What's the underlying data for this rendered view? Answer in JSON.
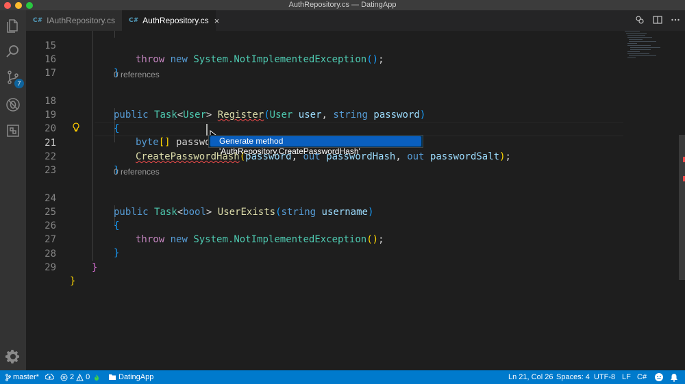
{
  "window": {
    "title": "AuthRepository.cs — DatingApp"
  },
  "activity_bar": {
    "items": [
      {
        "name": "explorer-icon"
      },
      {
        "name": "search-icon"
      },
      {
        "name": "source-control-icon",
        "badge": "7"
      },
      {
        "name": "debug-icon"
      },
      {
        "name": "extensions-icon"
      }
    ],
    "manage": "gear-icon"
  },
  "tabs": [
    {
      "icon": "C#",
      "label": "IAuthRepository.cs",
      "active": false
    },
    {
      "icon": "C#",
      "label": "AuthRepository.cs",
      "active": true,
      "close": "×"
    }
  ],
  "editor": {
    "lines": [
      {
        "num": "15",
        "text": "throw new System.NotImplementedException();"
      },
      {
        "num": "16",
        "text": "}"
      },
      {
        "num": "17",
        "text": ""
      },
      {
        "codelens": "0 references"
      },
      {
        "num": "18",
        "text": "public Task<User> Register(User user, string password)"
      },
      {
        "num": "19",
        "text": "{"
      },
      {
        "num": "20",
        "text": "byte[] passwordHash, passwordSalt;"
      },
      {
        "num": "21",
        "text": "CreatePasswordHash(password, out passwordHash, out passwordSalt);",
        "active": true
      },
      {
        "num": "22",
        "text": "}"
      },
      {
        "num": "23",
        "text": ""
      },
      {
        "codelens": "0 references"
      },
      {
        "num": "24",
        "text": "public Task<bool> UserExists(string username)"
      },
      {
        "num": "25",
        "text": "{"
      },
      {
        "num": "26",
        "text": "throw new System.NotImplementedException();"
      },
      {
        "num": "27",
        "text": "}"
      },
      {
        "num": "28",
        "text": "}"
      },
      {
        "num": "29",
        "text": "}"
      }
    ],
    "tokens": {
      "throw": "throw",
      "new": "new",
      "system_nie": "System.NotImplementedException",
      "end_call": "();",
      "public": "public",
      "task": "Task",
      "lt": "<",
      "gt": ">",
      "user_type": "User",
      "bool": "bool",
      "register": "Register",
      "string": "string",
      "password": "password",
      "user_param": "user",
      "byte": "byte",
      "brackets": "[]",
      "pwhash_salt_decl": " passwordHash, passwordSalt;",
      "create_pwhash": "CreatePasswordHash",
      "out": "out",
      "password_hash": "passwordHash",
      "password_salt": "passwordSalt",
      "user_exists": "UserExists",
      "username": "username",
      "comma": ", ",
      "open_paren": "(",
      "close_paren": ")",
      "semicolon": ";",
      "open_brace": "{",
      "close_brace": "}",
      "space": " "
    },
    "quick_fix": {
      "label": "Generate method 'AuthRepository.CreatePasswordHash'",
      "icon": "lightbulb-icon"
    }
  },
  "status_bar": {
    "branch": "master*",
    "errors": "2",
    "warnings": "0",
    "project": "DatingApp",
    "position": "Ln 21, Col 26",
    "spaces": "Spaces: 4",
    "encoding": "UTF-8",
    "eol": "LF",
    "language": "C#"
  },
  "colors": {
    "status_bar": "#007acc",
    "editor_bg": "#1e1e1e",
    "keyword": "#569cd6",
    "type": "#4ec9b0",
    "function": "#dcdcaa",
    "parameter": "#9cdcfe",
    "control": "#c586c0",
    "bracket_gold": "#ffd700",
    "bracket_orchid": "#da70d6",
    "bracket_blue": "#179fff"
  }
}
